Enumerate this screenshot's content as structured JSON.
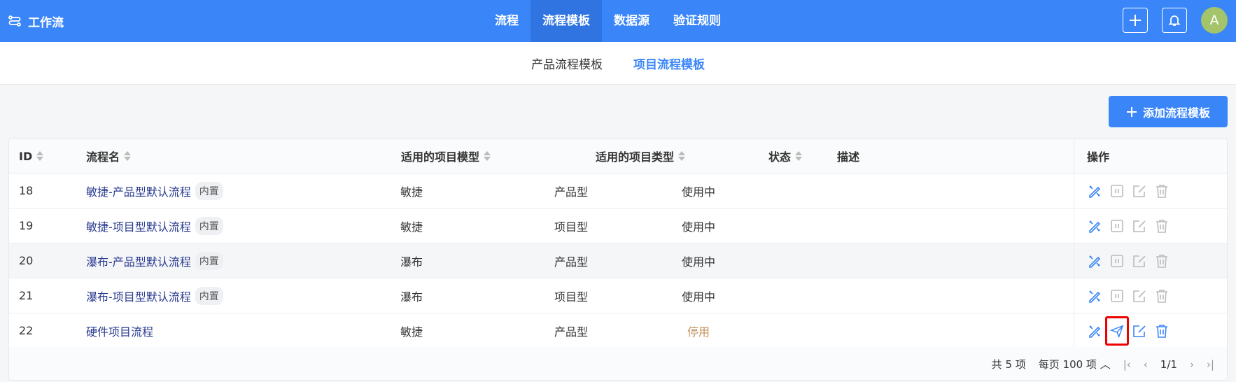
{
  "app": {
    "title": "工作流"
  },
  "nav": [
    {
      "label": "流程"
    },
    {
      "label": "流程模板"
    },
    {
      "label": "数据源"
    },
    {
      "label": "验证规则"
    }
  ],
  "user": {
    "avatar": "A"
  },
  "subnav": [
    {
      "label": "产品流程模板"
    },
    {
      "label": "项目流程模板"
    }
  ],
  "add_button": "添加流程模板",
  "columns": {
    "id": "ID",
    "name": "流程名",
    "model": "适用的项目模型",
    "type": "适用的项目类型",
    "status": "状态",
    "desc": "描述",
    "ops": "操作"
  },
  "rows": [
    {
      "id": "18",
      "name": "敏捷-产品型默认流程",
      "tag": "内置",
      "model": "敏捷",
      "type": "产品型",
      "status": "使用中"
    },
    {
      "id": "19",
      "name": "敏捷-项目型默认流程",
      "tag": "内置",
      "model": "敏捷",
      "type": "项目型",
      "status": "使用中"
    },
    {
      "id": "20",
      "name": "瀑布-产品型默认流程",
      "tag": "内置",
      "model": "瀑布",
      "type": "产品型",
      "status": "使用中"
    },
    {
      "id": "21",
      "name": "瀑布-项目型默认流程",
      "tag": "内置",
      "model": "瀑布",
      "type": "项目型",
      "status": "使用中"
    },
    {
      "id": "22",
      "name": "硬件项目流程",
      "tag": null,
      "model": "敏捷",
      "type": "产品型",
      "status": "停用"
    }
  ],
  "pager": {
    "total": "共 5 项",
    "per_page": "每页 100 项",
    "page": "1/1"
  },
  "colors": {
    "accent": "#3a86f8",
    "disabled": "#c0915a"
  }
}
